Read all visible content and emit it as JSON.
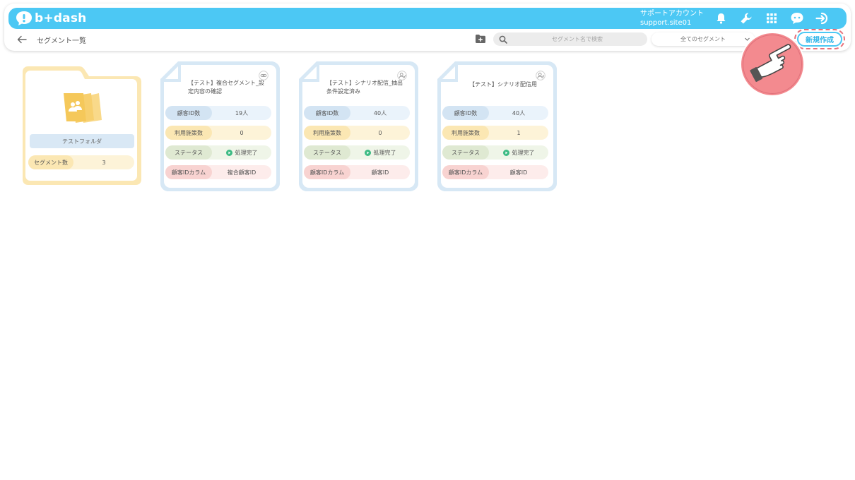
{
  "header": {
    "logo_text": "b+dash",
    "account_name": "サポートアカウント",
    "account_site": "support.site01",
    "brand_color": "#4cc8f4"
  },
  "subbar": {
    "page_title": "セグメント一覧",
    "search_placeholder": "セグメント名で検索",
    "segment_filter": "全てのセグメント",
    "new_button": "新規作成"
  },
  "folder": {
    "name": "テストフォルダ",
    "stat_label": "セグメント数",
    "stat_value": "3"
  },
  "segments": [
    {
      "title": "【テスト】複合セグメント_設定内容の確認",
      "ids_label": "顧客ID数",
      "ids_value": "19人",
      "meas_label": "利用施策数",
      "meas_value": "0",
      "status_label": "ステータス",
      "status_value": "処理完了",
      "col_label": "顧客IDカラム",
      "col_value": "複合顧客ID",
      "icon": "link-icon"
    },
    {
      "title": "【テスト】シナリオ配信_抽出条件設定済み",
      "ids_label": "顧客ID数",
      "ids_value": "40人",
      "meas_label": "利用施策数",
      "meas_value": "0",
      "status_label": "ステータス",
      "status_value": "処理完了",
      "col_label": "顧客IDカラム",
      "col_value": "顧客ID",
      "icon": "user-icon"
    },
    {
      "title": "【テスト】シナリオ配信用",
      "ids_label": "顧客ID数",
      "ids_value": "40人",
      "meas_label": "利用施策数",
      "meas_value": "1",
      "status_label": "ステータス",
      "status_value": "処理完了",
      "col_label": "顧客IDカラム",
      "col_value": "顧客ID",
      "icon": "user-icon"
    }
  ]
}
